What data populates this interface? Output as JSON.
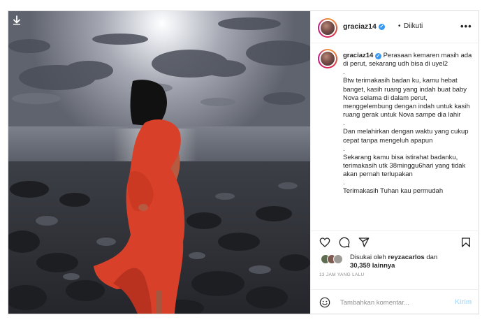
{
  "post": {
    "username": "graciaz14",
    "separator": "•",
    "follow_label": "Diikuti",
    "more_label": "•••",
    "caption_lines": [
      "Perasaan kemaren masih ada di perut, sekarang udh bisa di uyel2",
      ".",
      "Btw terimakasih badan ku, kamu hebat banget, kasih ruang yang indah buat baby Nova selama di dalam perut, menggelembung dengan indah untuk kasih ruang gerak untuk Nova sampe dia lahir",
      ".",
      "Dan melahirkan dengan waktu yang cukup cepat tanpa mengeluh apapun",
      ".",
      "Sekarang kamu bisa istirahat badanku, terimakasih utk 38minggu6hari yang tidak akan pernah terlupakan",
      ".",
      "Terimakasih Tuhan kau permudah"
    ],
    "likes_prefix": "Disukai oleh",
    "likes_user": "reyzacarlos",
    "likes_and": "dan",
    "likes_count": "30,359",
    "likes_suffix": "lainnya",
    "timestamp": "13 JAM YANG LALU",
    "comment_placeholder": "Tambahkan komentar...",
    "post_label": "Kirim"
  },
  "icons": {
    "download": "download-arrow-icon",
    "verified": "verified-badge-icon",
    "like": "heart-icon",
    "comment": "comment-bubble-icon",
    "share": "paper-plane-icon",
    "save": "bookmark-icon",
    "emoji": "smiley-icon"
  },
  "colors": {
    "verified": "#3897f0",
    "post_disabled": "#b2dffc",
    "dress": "#d9402a"
  }
}
